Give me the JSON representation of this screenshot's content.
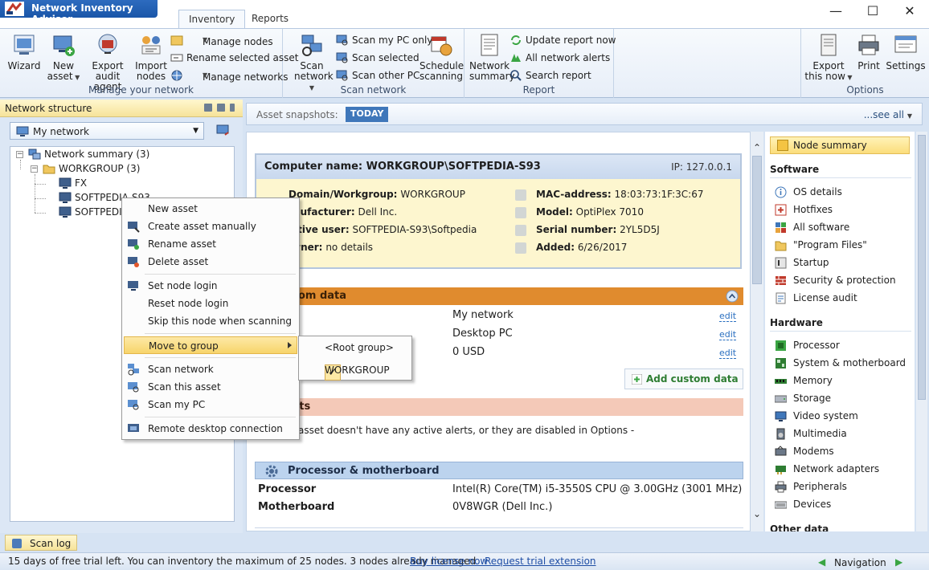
{
  "app": {
    "title": "Network Inventory Advisor"
  },
  "ribbon_tabs": [
    {
      "label": "Inventory"
    },
    {
      "label": "Reports"
    }
  ],
  "manage": {
    "wizard": "Wizard",
    "new_asset_1": "New",
    "new_asset_2": "asset",
    "export_agent_1": "Export",
    "export_agent_2": "audit agent",
    "import_1": "Import",
    "import_2": "nodes",
    "manage_nodes": "Manage nodes",
    "rename_selected": "Rename selected asset",
    "manage_networks": "Manage networks",
    "group_label": "Manage your network"
  },
  "scan": {
    "scan_network_1": "Scan",
    "scan_network_2": "network",
    "scan_my_pc": "Scan my PC only",
    "scan_selected": "Scan selected",
    "scan_other": "Scan other PC",
    "schedule_1": "Schedule",
    "schedule_2": "scanning",
    "group_label": "Scan network"
  },
  "report": {
    "summary_1": "Network",
    "summary_2": "summary",
    "update_now": "Update report now",
    "all_alerts": "All network alerts",
    "search": "Search report",
    "group_label": "Report"
  },
  "options": {
    "export_1": "Export",
    "export_2": "this now",
    "print": "Print",
    "settings": "Settings",
    "group_label": "Options"
  },
  "left": {
    "header": "Network structure",
    "network_select": "My network",
    "tree": {
      "root": "Network summary (3)",
      "group": "WORKGROUP (3)",
      "nodes": [
        "FX",
        "SOFTPEDIA-S93",
        "SOFTPEDIA"
      ]
    }
  },
  "context_menu": {
    "new_asset": "New asset",
    "create_manually": "Create asset manually",
    "rename": "Rename asset",
    "delete": "Delete asset",
    "set_login": "Set node login",
    "reset_login": "Reset node login",
    "skip": "Skip this node when scanning",
    "move_group": "Move to group",
    "scan_network": "Scan network",
    "scan_asset": "Scan this asset",
    "scan_pc": "Scan my PC",
    "remote": "Remote desktop connection"
  },
  "submenu": {
    "root": "<Root group>",
    "workgroup": "WORKGROUP"
  },
  "snapshots": {
    "label": "Asset snapshots:",
    "today": "TODAY",
    "see_all": "...see all"
  },
  "computer": {
    "name": "Computer name: WORKGROUP\\SOFTPEDIA-S93",
    "ip": "IP: 127.0.0.1",
    "domain_label": "Domain/Workgroup:",
    "domain_value": "WORKGROUP",
    "manufacturer_label": "anufacturer:",
    "manufacturer_value": "Dell Inc.",
    "user_label": "ctive user:",
    "user_value": "SOFTPEDIA-S93\\Softpedia",
    "owner_label": "wner:",
    "owner_value": "no details",
    "mac_label": "MAC-address:",
    "mac_value": "18:03:73:1F:3C:67",
    "model_label": "Model:",
    "model_value": "OptiPlex 7010",
    "serial_label": "Serial number:",
    "serial_value": "2YL5D5J",
    "added_label": "Added:",
    "added_value": "6/26/2017"
  },
  "custom": {
    "header": "stom data",
    "rows": [
      {
        "value": "My network",
        "edit": "edit"
      },
      {
        "value": "Desktop PC",
        "edit": "edit"
      },
      {
        "value": "0 USD",
        "edit": "edit"
      }
    ],
    "add": "Add custom data"
  },
  "alerts": {
    "header": "erts",
    "text": "asset doesn't have any active alerts, or they are disabled in Options -"
  },
  "processor": {
    "header": "Processor & motherboard",
    "rows": [
      {
        "label": "Processor",
        "value": "Intel(R) Core(TM) i5-3550S CPU @ 3.00GHz (3001 MHz)"
      },
      {
        "label": "Motherboard",
        "value": "0V8WGR (Dell Inc.)"
      }
    ]
  },
  "nav": {
    "node_summary": "Node summary",
    "software_head": "Software",
    "software": [
      "OS details",
      "Hotfixes",
      "All software",
      "\"Program Files\"",
      "Startup",
      "Security & protection",
      "License audit"
    ],
    "hardware_head": "Hardware",
    "hardware": [
      "Processor",
      "System & motherboard",
      "Memory",
      "Storage",
      "Video system",
      "Multimedia",
      "Modems",
      "Network adapters",
      "Peripherals",
      "Devices"
    ],
    "other_head": "Other data"
  },
  "bottom": {
    "scan_log": "Scan log",
    "status": "15 days of free trial left. You can inventory the maximum of 25 nodes. 3 nodes already managed",
    "buy": "Buy license now",
    "trial": "Request trial extension",
    "navigation": "Navigation"
  }
}
